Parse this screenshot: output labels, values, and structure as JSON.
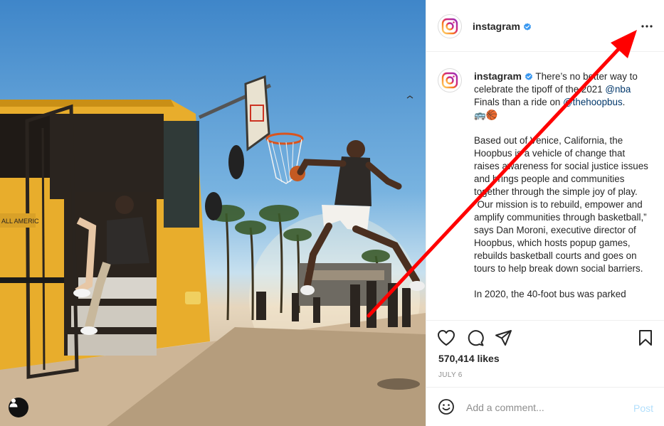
{
  "post": {
    "image_alt": "Player dunking on a hoop mounted on a yellow school bus at Venice Beach",
    "username": "instagram",
    "verified": true,
    "more_options_icon": "more-horizontal-icon"
  },
  "caption": {
    "username": "instagram",
    "text_1": "There’s no better way to celebrate the tipoff of the 2021 ",
    "mention_1": "@nba",
    "text_2": " Finals than a ride on ",
    "mention_2": "@thehoopbus",
    "text_3": ".",
    "emojis": "🚌🏀",
    "paragraph_2": "Based out of Venice, California, the Hoopbus is a vehicle of change that raises awareness for social justice issues and brings people and communities together through the simple joy of play. “Our mission is to rebuild, empower and amplify communities through basketball,” says Dan Moroni, executive director of Hoopbus, which hosts popup games, rebuilds basketball courts and goes on tours to help break down social barriers.",
    "paragraph_3": "In 2020, the 40-foot bus was parked"
  },
  "actions": {
    "like_icon": "heart-icon",
    "comment_icon": "comment-icon",
    "share_icon": "paper-plane-icon",
    "save_icon": "bookmark-icon",
    "likes": "570,414 likes",
    "date": "JULY 6"
  },
  "comment_box": {
    "emoji_icon": "smiley-icon",
    "placeholder": "Add a comment...",
    "post_label": "Post"
  },
  "colors": {
    "text": "#262626",
    "secondary": "#8e8e8e",
    "link": "#00376b",
    "post_disabled": "#b2dffc",
    "verified": "#3897f0",
    "annotation_arrow": "#ff0000"
  }
}
